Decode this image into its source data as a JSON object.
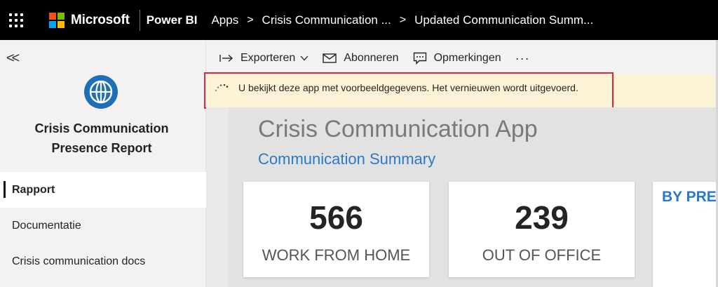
{
  "topbar": {
    "brand": "Microsoft",
    "product": "Power BI",
    "breadcrumbs": [
      "Apps",
      "Crisis Communication ...",
      "Updated Communication Summ..."
    ],
    "brand_colors": [
      "#f25022",
      "#7fba00",
      "#00a4ef",
      "#ffb900"
    ]
  },
  "sidebar": {
    "app_title_line1": "Crisis Communication",
    "app_title_line2": "Presence Report",
    "app_icon": "globe-icon",
    "items": [
      {
        "label": "Rapport",
        "active": true
      },
      {
        "label": "Documentatie",
        "active": false
      },
      {
        "label": "Crisis communication docs",
        "active": false
      }
    ]
  },
  "toolbar": {
    "export_label": "Exporteren",
    "subscribe_label": "Abonneren",
    "comments_label": "Opmerkingen",
    "more_label": "···"
  },
  "banner": {
    "message": "U bekijkt deze app met voorbeeldgegevens. Het vernieuwen wordt uitgevoerd."
  },
  "report": {
    "title": "Crisis Communication App",
    "subtitle": "Communication Summary",
    "cards": [
      {
        "value": "566",
        "label": "WORK FROM HOME"
      },
      {
        "value": "239",
        "label": "OUT OF OFFICE"
      }
    ],
    "partial_card_title": "BY PRE"
  },
  "colors": {
    "accent_blue": "#2a7ac8",
    "banner_bg": "#fcf3d6",
    "highlight_red": "#d9283a"
  }
}
